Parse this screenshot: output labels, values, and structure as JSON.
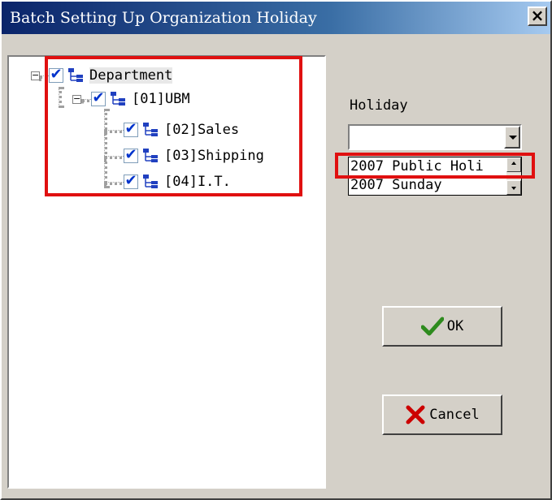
{
  "window": {
    "title": "Batch Setting Up Organization Holiday",
    "close_glyph": "×"
  },
  "tree": {
    "root": {
      "label": "Department",
      "checked": true,
      "icon": "org-chart-icon",
      "expander": "−"
    },
    "children": [
      {
        "label": "[01]UBM",
        "checked": true,
        "icon": "org-chart-icon",
        "expander": "−",
        "children": [
          {
            "label": "[02]Sales",
            "checked": true,
            "icon": "org-chart-icon"
          },
          {
            "label": "[03]Shipping",
            "checked": true,
            "icon": "org-chart-icon"
          },
          {
            "label": "[04]I.T.",
            "checked": true,
            "icon": "org-chart-icon"
          }
        ]
      }
    ],
    "check_glyph": "✔"
  },
  "holiday": {
    "label": "Holiday",
    "value": "",
    "options": [
      "2007 Public Holi",
      "2007 Sunday"
    ]
  },
  "buttons": {
    "ok_label": "OK",
    "ok_icon": "checkmark-icon",
    "cancel_label": "Cancel",
    "cancel_icon": "x-mark-icon"
  },
  "colors": {
    "highlight_box": "#e01010",
    "check": "#0033cc",
    "ok_icon": "#2e8b1e",
    "cancel_icon": "#cc0000"
  }
}
